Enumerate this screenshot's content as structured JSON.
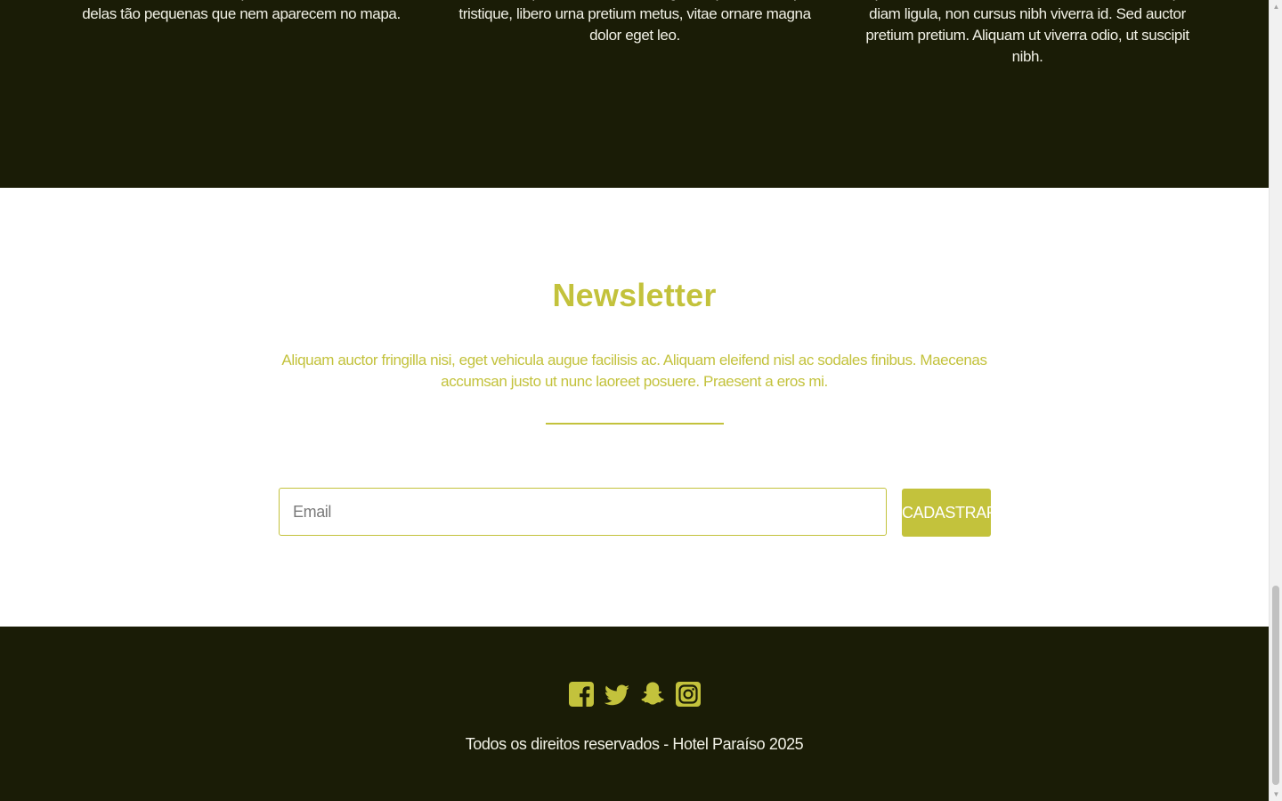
{
  "features": {
    "columns": [
      {
        "text": "refrescantes cachoeiras, praias belíssimas, muitas delas tão pequenas que nem aparecem no mapa."
      },
      {
        "text": "elementum purus. Nam ultrices, ligula imperdiet volutpat tristique, libero urna pretium metus, vitae ornare magna dolor eget leo."
      },
      {
        "text": "sapien. Nulla finibus rutrum mattis. Donec consequat diam ligula, non cursus nibh viverra id. Sed auctor pretium pretium. Aliquam ut viverra odio, ut suscipit nibh."
      }
    ]
  },
  "newsletter": {
    "title": "Newsletter",
    "text": "Aliquam auctor fringilla nisi, eget vehicula augue facilisis ac. Aliquam eleifend nisl ac sodales finibus. Maecenas accumsan justo ut nunc laoreet posuere. Praesent a eros mi.",
    "email_placeholder": "Email",
    "email_value": "",
    "button_label": "CADASTRAR"
  },
  "footer": {
    "socials": [
      {
        "icon": "facebook-icon"
      },
      {
        "icon": "twitter-icon"
      },
      {
        "icon": "snapchat-icon"
      },
      {
        "icon": "instagram-icon"
      }
    ],
    "copyright": "Todos os direitos reservados - Hotel Paraíso 2025"
  },
  "colors": {
    "dark_bg": "#1a1c06",
    "accent": "#c3c23c",
    "light_text": "#f1f1e6"
  }
}
